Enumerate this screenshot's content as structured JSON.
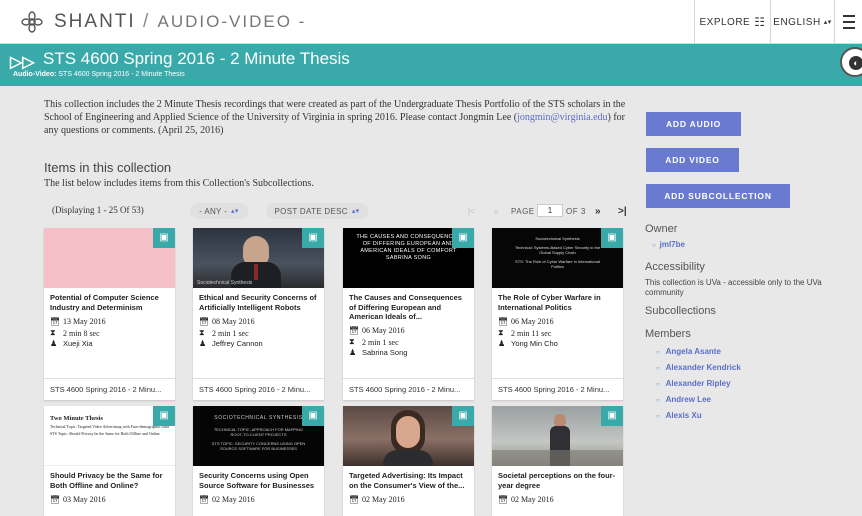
{
  "header": {
    "site_name": "SHANTI",
    "separator": "/",
    "section": "AUDIO-VIDEO -",
    "explore_label": "EXPLORE",
    "language_label": "ENGLISH",
    "menu_icon": "hamburger-icon"
  },
  "banner": {
    "title": "STS 4600 Spring 2016 - 2 Minute Thesis",
    "crumb_label": "Audio-Video:",
    "crumb_value": "STS 4600 Spring 2016 - 2 Minute Thesis",
    "color": "#3aa9aa"
  },
  "description": {
    "text_before": "This collection includes the 2 Minute Thesis recordings that were created as part of the Undergraduate Thesis Portfolio of the STS scholars in the School of Engineering and Applied Science of the University of Virginia in spring 2016. Please contact Jongmin Lee (",
    "email": "jongmin@virginia.edu",
    "text_after": ") for any questions or comments. (April 25, 2016)"
  },
  "items": {
    "heading": "Items in this collection",
    "note": "The list below includes items from this Collection's Subcollections.",
    "display_count": "(Displaying 1 - 25 Of 53)",
    "filter_label": "- ANY -",
    "sort_label": "POST DATE DESC",
    "pager": {
      "first": "|<",
      "prev": "«",
      "page_label": "PAGE",
      "page_value": "1",
      "of_label": "OF 3",
      "next": "»",
      "last": ">|"
    }
  },
  "cards": [
    {
      "title": "Potential of Computer Science Industry and Determinism",
      "date": "13 May 2016",
      "duration": "2 min 8 sec",
      "author": "Xueji Xia",
      "collection": "STS 4600 Spring 2016 - 2 Minu..."
    },
    {
      "title": "Ethical and Security Concerns of Artificially Intelligent Robots",
      "date": "08 May 2016",
      "duration": "2 min 1 sec",
      "author": "Jeffrey Cannon",
      "collection": "STS 4600 Spring 2016 - 2 Minu...",
      "thumb_caption": "Sociotechnical Synthesis"
    },
    {
      "title": "The Causes and Consequences of Differing European and American Ideals of...",
      "date": "06 May 2016",
      "duration": "2 min 1 sec",
      "author": "Sabrina Song",
      "collection": "STS 4600 Spring 2016 - 2 Minu...",
      "thumb_text": "THE CAUSES AND CONSEQUENCES OF DIFFERING EUROPEAN AND AMERICAN IDEALS OF COMFORT SABRINA SONG"
    },
    {
      "title": "The Role of Cyber Warfare in International Politics",
      "date": "06 May 2016",
      "duration": "2 min 11 sec",
      "author": "Yong Min Cho",
      "collection": "STS 4600 Spring 2016 - 2 Minu...",
      "thumb_text_1": "Sociotechnical Synthesis",
      "thumb_text_2": "Technical: Systems-Based Cyber Security in the Global Supply Chain",
      "thumb_text_3": "STS: The Role of Cyber Warfare in International Politics"
    },
    {
      "title": "Should Privacy be the Same for Both Offline and Online?",
      "date": "03 May 2016",
      "thumb_heading": "Two Minute Thesis",
      "thumb_line_1": "Technical Topic: Targeted Video Advertising with Face-demographic Data",
      "thumb_line_2": "STS Topic: Should Privacy be the Same for Both Offline and Online"
    },
    {
      "title": "Security Concerns using Open Source Software for Businesses",
      "date": "02 May 2016",
      "thumb_text_1": "SOCIOTECHNICAL SYNTHESIS",
      "thumb_text_2": "TECHNICAL TOPIC: APPROACH FOR MAPPING ROOT-TO-CLIENT PROJECTS",
      "thumb_text_3": "STS TOPIC: SECURITY CONCERNS USING OPEN SOURCE SOFTWARE FOR BUSINESSES"
    },
    {
      "title": "Targeted Advertising: Its Impact on the Consumer's View of the...",
      "date": "02 May 2016"
    },
    {
      "title": "Societal perceptions on the four-year degree",
      "date": "02 May 2016"
    }
  ],
  "sidebar": {
    "add_audio": "ADD AUDIO",
    "add_video": "ADD VIDEO",
    "add_subcollection": "ADD SUBCOLLECTION",
    "owner_heading": "Owner",
    "owner": "jml7be",
    "accessibility_heading": "Accessibility",
    "accessibility_text": "This collection is UVa - accessible only to the UVa community",
    "subcollections_heading": "Subcollections",
    "members_heading": "Members",
    "members": [
      "Angela Asante",
      "Alexander Kendrick",
      "Alexander Ripley",
      "Andrew Lee",
      "Alexis Xu"
    ],
    "button_color": "#6a7ad1"
  }
}
